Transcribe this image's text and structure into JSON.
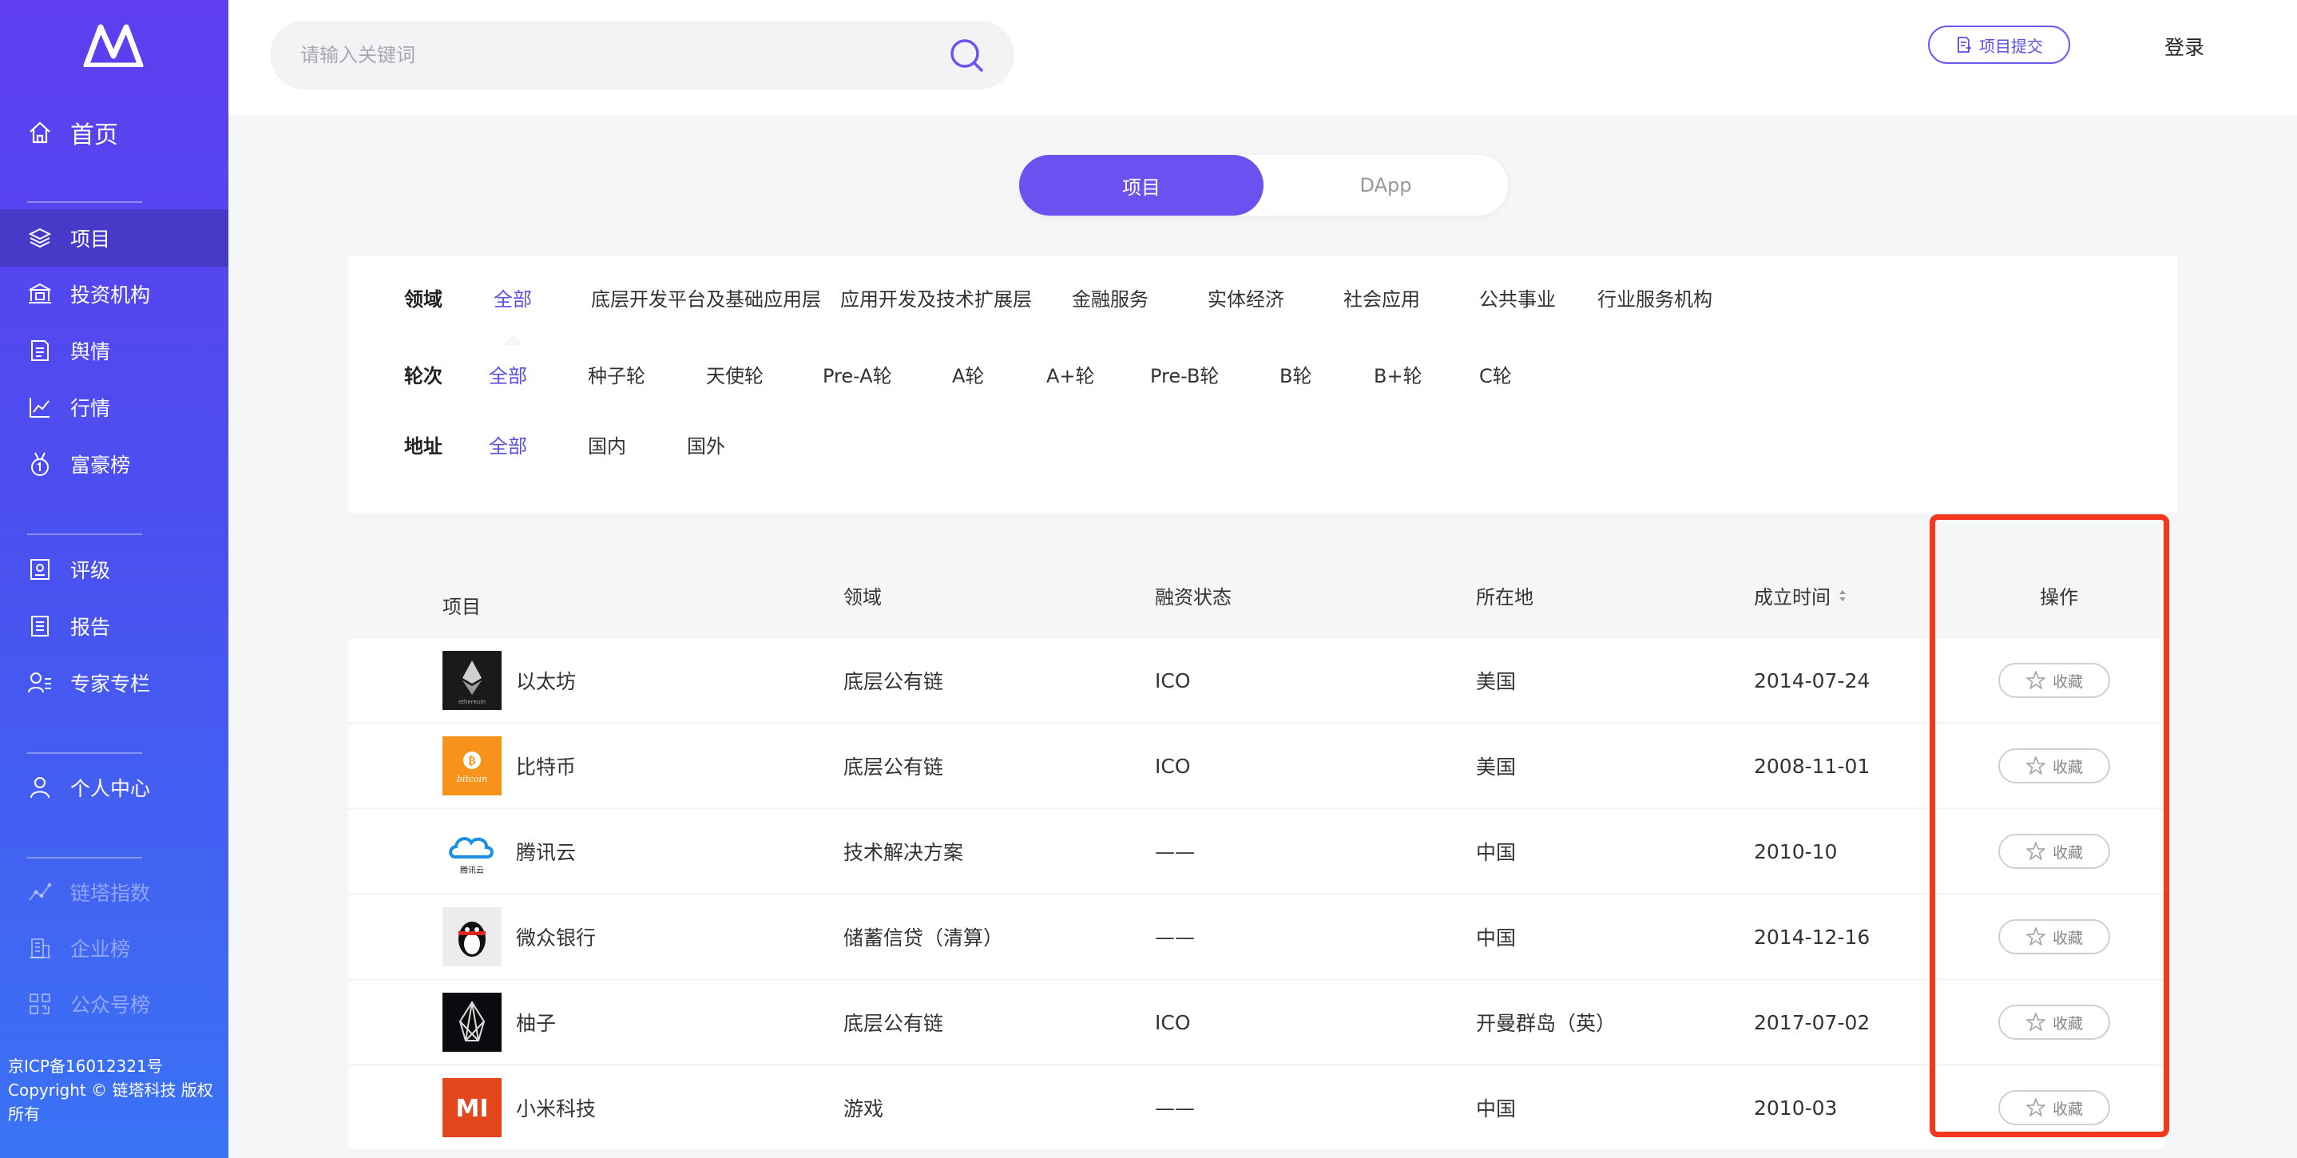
{
  "sidebar": {
    "home": "首页",
    "items": [
      {
        "label": "项目",
        "icon": "layers-icon"
      },
      {
        "label": "投资机构",
        "icon": "bank-icon"
      },
      {
        "label": "舆情",
        "icon": "document-icon"
      },
      {
        "label": "行情",
        "icon": "chart-line-icon"
      },
      {
        "label": "富豪榜",
        "icon": "medal-icon"
      },
      {
        "label": "评级",
        "icon": "rating-icon"
      },
      {
        "label": "报告",
        "icon": "report-icon"
      },
      {
        "label": "专家专栏",
        "icon": "experts-icon"
      },
      {
        "label": "个人中心",
        "icon": "user-icon"
      },
      {
        "label": "链塔指数",
        "icon": "index-icon"
      },
      {
        "label": "企业榜",
        "icon": "building-icon"
      },
      {
        "label": "公众号榜",
        "icon": "qrcode-icon"
      }
    ],
    "footer_icp": "京ICP备16012321号",
    "footer_copyright": "Copyright © 链塔科技 版权所有"
  },
  "header": {
    "search_placeholder": "请输入关键词",
    "submit_label": "项目提交",
    "login_label": "登录"
  },
  "tabs": [
    {
      "label": "项目",
      "active": true
    },
    {
      "label": "DApp",
      "active": false
    }
  ],
  "filters": {
    "domain": {
      "label": "领域",
      "options": [
        "全部",
        "底层开发平台及基础应用层",
        "应用开发及技术扩展层",
        "金融服务",
        "实体经济",
        "社会应用",
        "公共事业",
        "行业服务机构"
      ],
      "selected": "全部"
    },
    "round": {
      "label": "轮次",
      "options": [
        "全部",
        "种子轮",
        "天使轮",
        "Pre-A轮",
        "A轮",
        "A+轮",
        "Pre-B轮",
        "B轮",
        "B+轮",
        "C轮"
      ],
      "selected": "全部"
    },
    "location": {
      "label": "地址",
      "options": [
        "全部",
        "国内",
        "国外"
      ],
      "selected": "全部"
    }
  },
  "table": {
    "columns": [
      "项目",
      "领域",
      "融资状态",
      "所在地",
      "成立时间",
      "操作"
    ],
    "rows": [
      {
        "name": "以太坊",
        "logo": "ethereum",
        "domain": "底层公有链",
        "status": "ICO",
        "location": "美国",
        "founded": "2014-07-24"
      },
      {
        "name": "比特币",
        "logo": "bitcoin",
        "domain": "底层公有链",
        "status": "ICO",
        "location": "美国",
        "founded": "2008-11-01"
      },
      {
        "name": "腾讯云",
        "logo": "tencent-cloud",
        "domain": "技术解决方案",
        "status": "——",
        "location": "中国",
        "founded": "2010-10"
      },
      {
        "name": "微众银行",
        "logo": "webank",
        "domain": "储蓄信贷（清算）",
        "status": "——",
        "location": "中国",
        "founded": "2014-12-16"
      },
      {
        "name": "柚子",
        "logo": "eos",
        "domain": "底层公有链",
        "status": "ICO",
        "location": "开曼群岛（英）",
        "founded": "2017-07-02"
      },
      {
        "name": "小米科技",
        "logo": "xiaomi",
        "domain": "游戏",
        "status": "——",
        "location": "中国",
        "founded": "2010-03"
      }
    ],
    "action_label": "收藏"
  },
  "logo_text": {
    "ethereum": "ethereum",
    "bitcoin": "bitcoin",
    "tencent": "腾讯云",
    "xiaomi": "MI"
  },
  "colors": {
    "accent": "#6b51f0",
    "highlight_box": "#f2381d"
  }
}
